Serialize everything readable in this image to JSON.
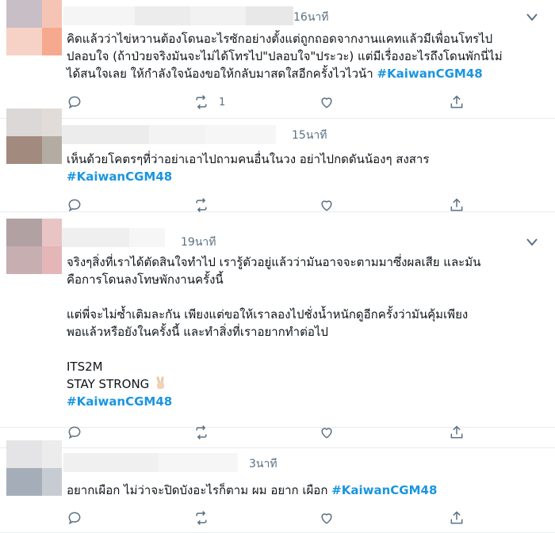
{
  "tweets": [
    {
      "time": "16นาที",
      "lines": [
        "คิดแล้วว่าไข่หวานต้องโดนอะไรซักอย่างตั้งแต่ถูกถอดจากงานแคทแล้วมีเพื่อนโทรไป",
        "ปลอบใจ (ถ้าป่วยจริงมันจะไม่ได้โทรไป\"ปลอบใจ\"ประวะ) แต่มีเรื่องอะไรถึงโดนพักนี่ไม่",
        "ได้สนใจเลย ให้กำลังใจน้องขอให้กลับมาสดใสอีกครั้งไวไวน้า "
      ],
      "hashtag": "#KaiwanCGM48",
      "retweet_count": "1"
    },
    {
      "time": "15นาที",
      "lines": [
        "เห็นด้วยโคตรๆที่ว่าอย่าเอาไปถามคนอื่นในวง อย่าไปกดดันน้องๆ สงสาร"
      ],
      "hashtag": "#KaiwanCGM48",
      "retweet_count": ""
    },
    {
      "time": "19นาที",
      "lines": [
        "จริงๆสิ่งที่เราได้ตัดสินใจทำไป เรารู้ตัวอยู่แล้วว่ามันอาจจะตามมาซึ่งผลเสีย และมัน",
        "คือการโดนลงโทษพักงานครั้งนี้",
        "",
        "แต่พี่จะไม่ซ้ำเติมละกัน เพียงแต่ขอให้เราลองไปชั่งน้ำหนักดูอีกครั้งว่ามันคุ้มเพียง",
        "พอแล้วหรือยังในครั้งนี้ และทำสิ่งที่เราอยากทำต่อไป",
        "",
        "ITS2M",
        "STAY STRONG"
      ],
      "hashtag": "#KaiwanCGM48",
      "retweet_count": ""
    },
    {
      "time": "3นาที",
      "lines": [
        "อยากเผือก ไม่ว่าจะปิดบังอะไรก็ตาม ผม อยาก เผือก "
      ],
      "hashtag": "#KaiwanCGM48",
      "retweet_count": ""
    }
  ],
  "icons": {
    "reply": "reply-icon",
    "retweet": "retweet-icon",
    "like": "heart-icon",
    "share": "share-icon",
    "more": "chevron-down-icon",
    "emoji": "victory-hand-icon"
  },
  "colors": {
    "hashtag": "#1b95e0",
    "meta": "#5b7083",
    "divider": "#e6ecf0"
  }
}
